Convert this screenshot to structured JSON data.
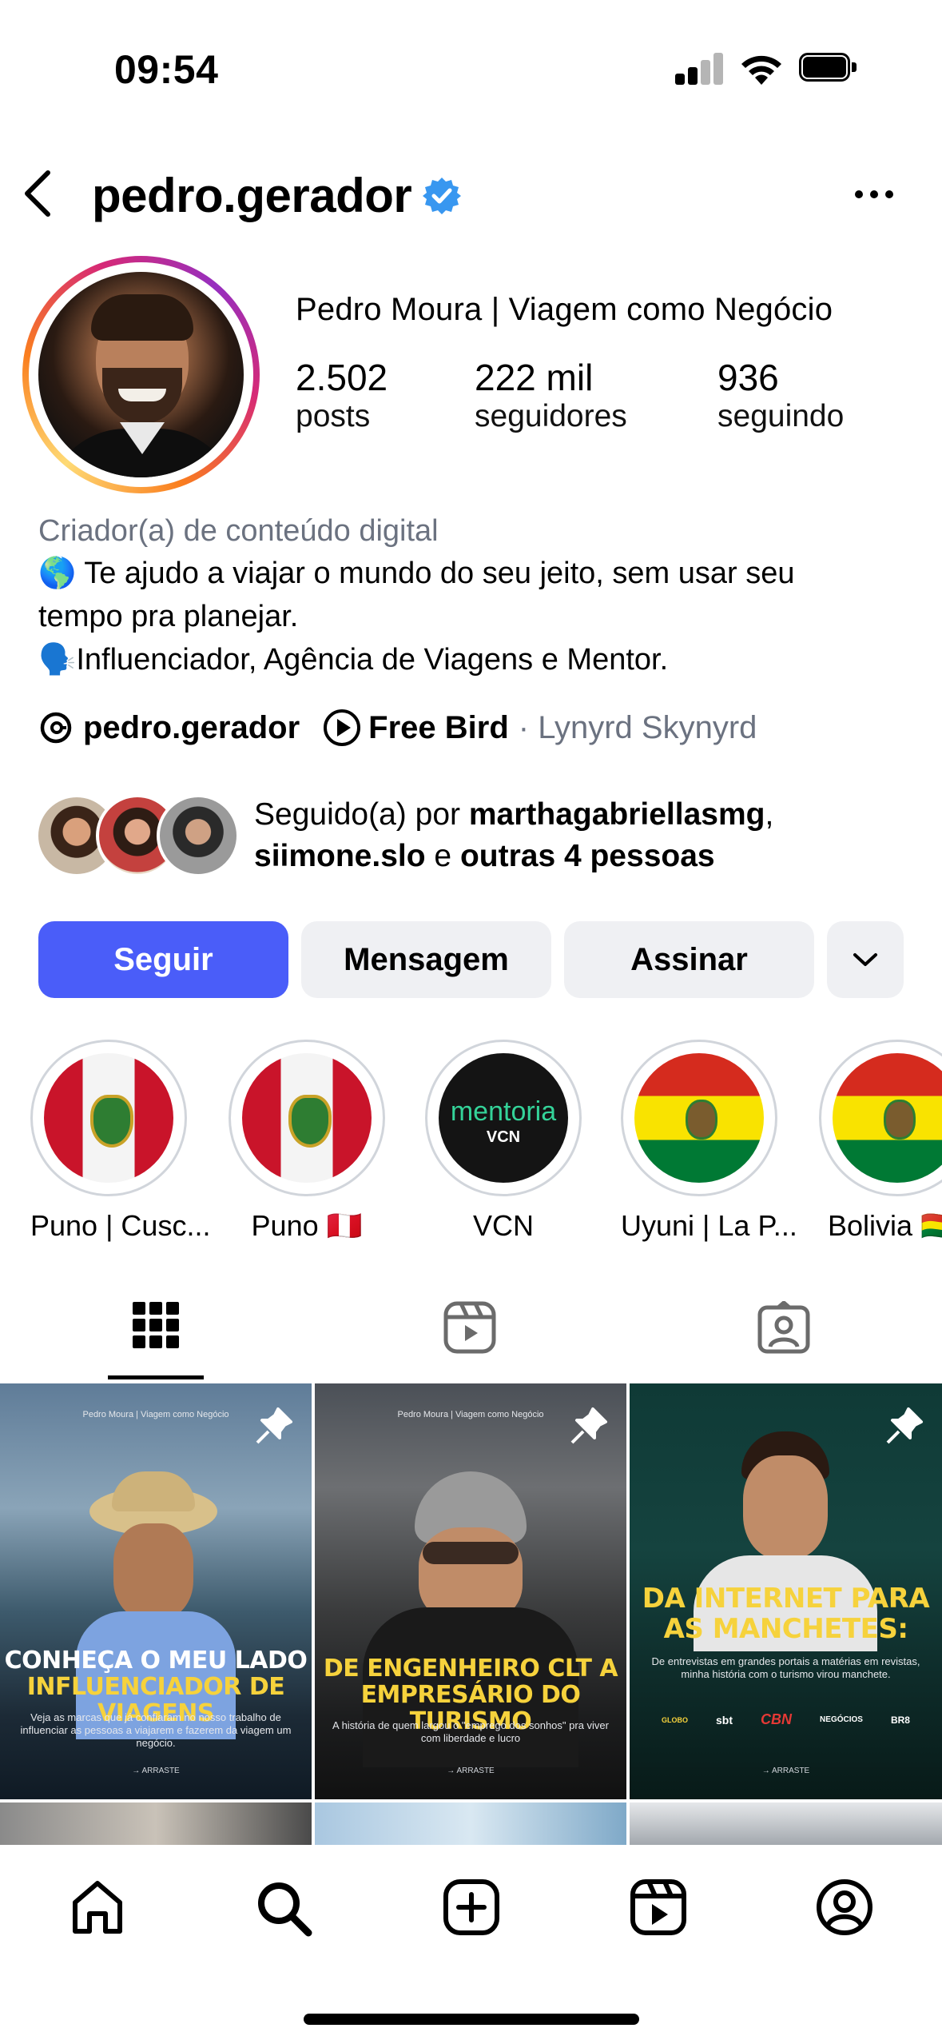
{
  "status_bar": {
    "time": "09:54"
  },
  "header": {
    "username": "pedro.gerador"
  },
  "profile": {
    "display_name": "Pedro Moura | Viagem como Negócio",
    "stats": [
      {
        "value": "2.502",
        "label": "posts"
      },
      {
        "value": "222 mil",
        "label": "seguidores"
      },
      {
        "value": "936",
        "label": "seguindo"
      }
    ]
  },
  "bio": {
    "category": "Criador(a) de conteúdo digital",
    "line1_emoji": "🌎",
    "line1": "Te ajudo a viajar o mundo do seu jeito, sem usar seu",
    "line2": "tempo pra planejar.",
    "line3_emoji": "🗣️",
    "line3": "Influenciador, Agência de Viagens e Mentor."
  },
  "links": {
    "threads_handle": "pedro.gerador",
    "music_title": "Free Bird",
    "music_artist": "· Lynyrd Skynyrd"
  },
  "followed_by": {
    "prefix": "Seguido(a) por ",
    "user1": "marthagabriellasmg",
    "sep1": ",",
    "user2": "siimone.slo",
    "mid": " e ",
    "others": "outras 4 pessoas"
  },
  "buttons": {
    "follow": "Seguir",
    "message": "Mensagem",
    "subscribe": "Assinar"
  },
  "highlights": [
    {
      "label": "Puno | Cusc..."
    },
    {
      "label": "Puno 🇵🇪"
    },
    {
      "label": "VCN",
      "art_title": "mentoria",
      "art_sub": "VCN"
    },
    {
      "label": "Uyuni | La P..."
    },
    {
      "label": "Bolivia 🇧🇴"
    }
  ],
  "posts": [
    {
      "header": "Pedro Moura | Viagem como Negócio",
      "title_line1": "CONHEÇA O MEU LADO",
      "title_line2": "INFLUENCIADOR DE VIAGENS",
      "subtitle": "Veja as marcas que já confiaram no nosso trabalho de influenciar as pessoas a viajarem e fazerem da viagem um negócio.",
      "cta": "→ ARRASTE"
    },
    {
      "header": "Pedro Moura | Viagem como Negócio",
      "title_line1": "DE ENGENHEIRO CLT A",
      "title_line2": "EMPRESÁRIO DO TURISMO",
      "subtitle": "A história de quem largou o \"emprego dos sonhos\" pra viver com liberdade e lucro",
      "cta": "→ ARRASTE"
    },
    {
      "title_line1": "DA INTERNET PARA",
      "title_line2": "AS MANCHETES:",
      "subtitle": "De entrevistas em grandes portais a matérias em revistas, minha história com o turismo virou manchete.",
      "logos": [
        "GLOBO",
        "sbt",
        "CBN",
        "NEGÓCIOS",
        "BR8"
      ],
      "cta": "→ ARRASTE"
    }
  ],
  "colors": {
    "follow_button": "#4a5df9",
    "gray_button": "#eff0f3",
    "verified": "#3897f0",
    "post_yellow": "#f6d23c"
  }
}
